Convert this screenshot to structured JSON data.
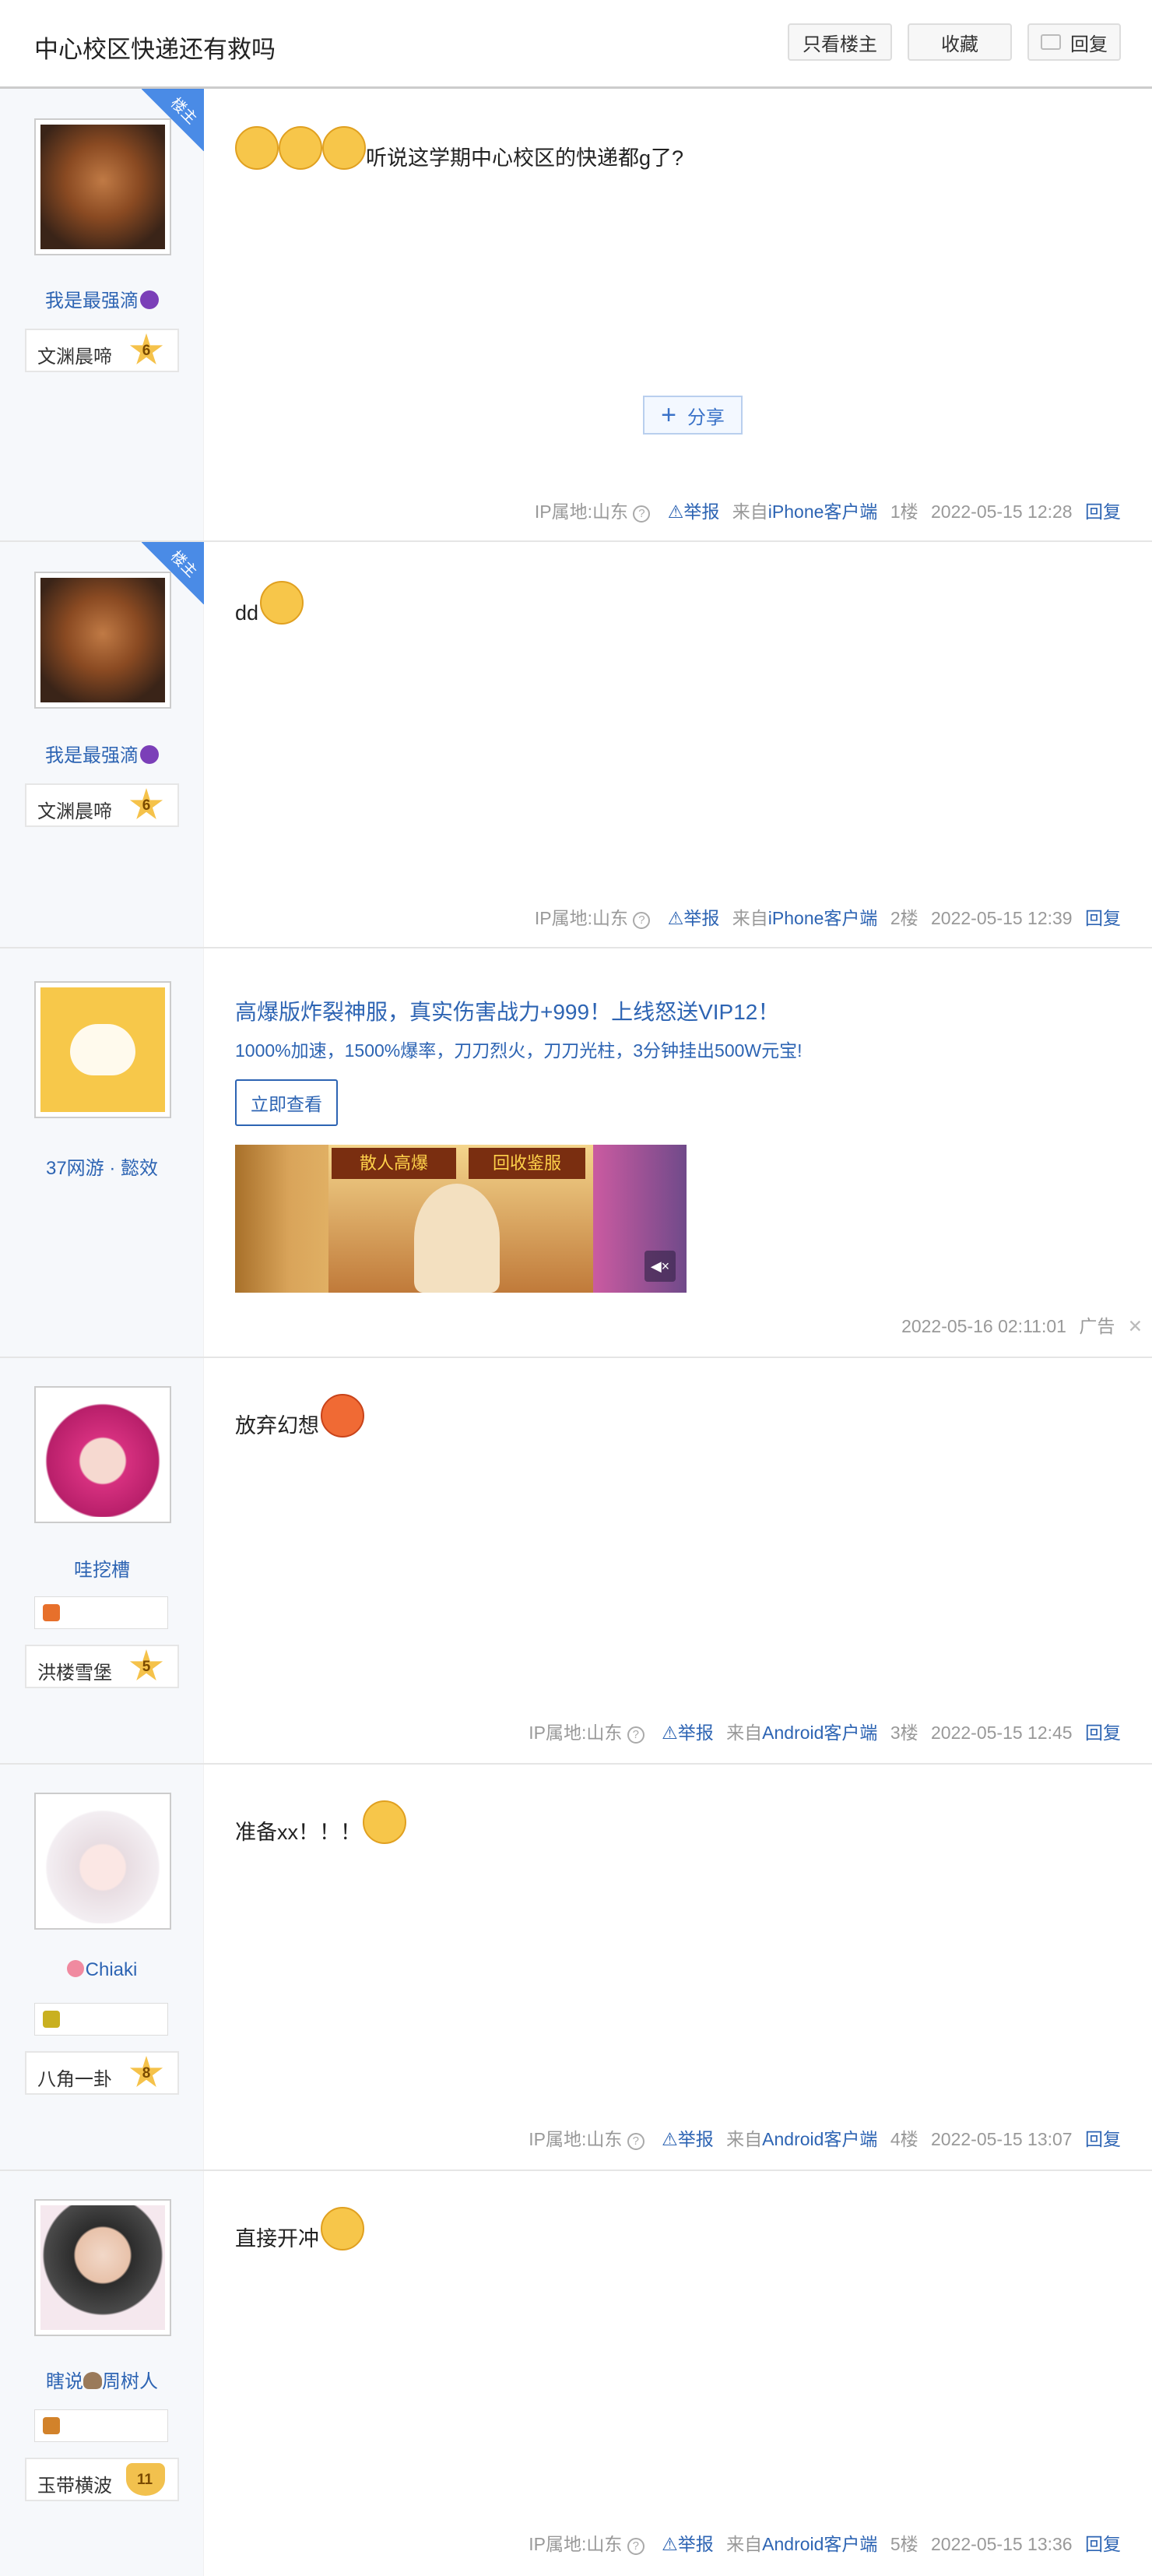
{
  "thread": {
    "title": "中心校区快递还有救吗",
    "buttons": {
      "only_op": "只看楼主",
      "favorite": "收藏",
      "reply": "回复"
    }
  },
  "common": {
    "op_badge": "楼主",
    "share_label": "分享",
    "ip_label": "IP属地:山东",
    "report_label": "举报",
    "reply_label": "回复",
    "help_glyph": "?"
  },
  "posts": [
    {
      "username": "我是最强滴",
      "level_name": "文渊晨啼",
      "level": "6",
      "content": "听说这学期中心校区的快递都g了?",
      "source_prefix": "来自",
      "source_client": "iPhone客户端",
      "floor": "1楼",
      "time": "2022-05-15 12:28"
    },
    {
      "username": "我是最强滴",
      "level_name": "文渊晨啼",
      "level": "6",
      "content": "dd",
      "source_prefix": "来自",
      "source_client": "iPhone客户端",
      "floor": "2楼",
      "time": "2022-05-15 12:39"
    },
    {
      "username": "哇挖槽",
      "level_name": "洪楼雪堡",
      "level": "5",
      "content": "放弃幻想",
      "source_prefix": "来自",
      "source_client": "Android客户端",
      "floor": "3楼",
      "time": "2022-05-15 12:45"
    },
    {
      "username": "Chiaki",
      "level_name": "八角一卦",
      "level": "8",
      "content": "准备xx！！！",
      "source_prefix": "来自",
      "source_client": "Android客户端",
      "floor": "4楼",
      "time": "2022-05-15 13:07"
    },
    {
      "username_prefix": "瞎说",
      "username": "周树人",
      "level_name": "玉带横波",
      "level": "11",
      "content": "直接开冲",
      "source_prefix": "来自",
      "source_client": "Android客户端",
      "floor": "5楼",
      "time": "2022-05-15 13:36"
    }
  ],
  "ad": {
    "advertiser": "37网游 · 懿效",
    "title": "高爆版炸裂神服，真实伤害战力+999！上线怒送VIP12！",
    "description": "1000%加速，1500%爆率，刀刀烈火，刀刀光柱，3分钟挂出500W元宝!",
    "cta": "立即查看",
    "image_text_left": "散人高爆",
    "image_text_right": "回收鉴服",
    "time": "2022-05-16 02:11:01",
    "ad_label": "广告",
    "close_glyph": "✕",
    "mute_glyph": "◀×"
  }
}
